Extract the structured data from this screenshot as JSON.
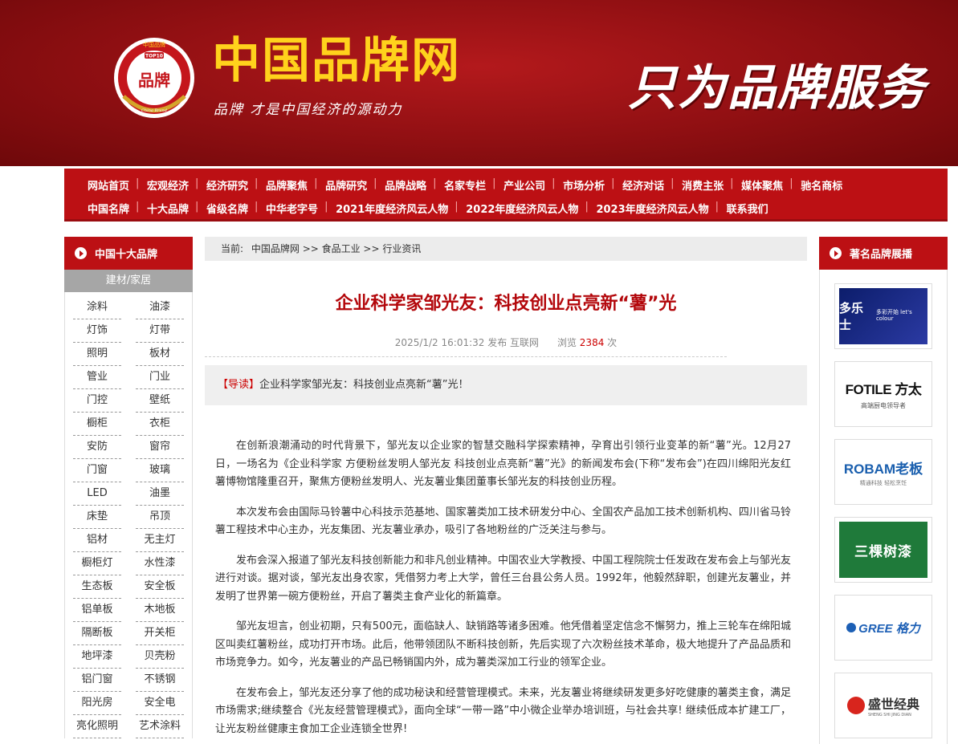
{
  "header": {
    "site_title": "中国品牌网",
    "slogan": "品牌  才是中国经济的源动力",
    "motto": "只为品牌服务",
    "seal_top": "中国品牌",
    "seal_badge": "TOP10",
    "seal_center": "品牌",
    "seal_bottom": "China Brand"
  },
  "nav": {
    "row1": [
      "网站首页",
      "宏观经济",
      "经济研究",
      "品牌聚焦",
      "品牌研究",
      "品牌战略",
      "名家专栏",
      "产业公司",
      "市场分析",
      "经济对话",
      "消费主张",
      "媒体聚焦",
      "驰名商标"
    ],
    "row2": [
      "中国名牌",
      "十大品牌",
      "省级名牌",
      "中华老字号",
      "2021年度经济风云人物",
      "2022年度经济风云人物",
      "2023年度经济风云人物",
      "联系我们"
    ]
  },
  "left_sidebar": {
    "title": "中国十大品牌",
    "category": "建材/家居",
    "items": [
      "涂料",
      "油漆",
      "灯饰",
      "灯带",
      "照明",
      "板材",
      "管业",
      "门业",
      "门控",
      "壁纸",
      "橱柜",
      "衣柜",
      "安防",
      "窗帘",
      "门窗",
      "玻璃",
      "LED",
      "油墨",
      "床垫",
      "吊顶",
      "铝材",
      "无主灯",
      "橱柜灯",
      "水性漆",
      "生态板",
      "安全板",
      "铝单板",
      "木地板",
      "隔断板",
      "开关柜",
      "地坪漆",
      "贝壳粉",
      "铝门窗",
      "不锈钢",
      "阳光房",
      "安全电",
      "亮化照明",
      "艺术涂料"
    ]
  },
  "breadcrumb": {
    "prefix": "当前:",
    "path": "中国品牌网 >> 食品工业 >> 行业资讯"
  },
  "article": {
    "title": "企业科学家邹光友：科技创业点亮新“薯”光",
    "date": "2025/1/2 16:01:32 发布",
    "source": "互联网",
    "views_label": "浏览",
    "views": "2384",
    "views_unit": "次",
    "lead_tag": "【导读】",
    "lead_text": "企业科学家邹光友：科技创业点亮新“薯”光！",
    "paragraphs": [
      "在创新浪潮涌动的时代背景下，邹光友以企业家的智慧交融科学探索精神，孕育出引领行业变革的新“薯”光。12月27日，一场名为《企业科学家 方便粉丝发明人邹光友 科技创业点亮新“薯”光》的新闻发布会(下称“发布会”)在四川绵阳光友红薯博物馆隆重召开，聚焦方便粉丝发明人、光友薯业集团董事长邹光友的科技创业历程。",
      "本次发布会由国际马铃薯中心科技示范基地、国家薯类加工技术研发分中心、全国农产品加工技术创新机构、四川省马铃薯工程技术中心主办，光友集团、光友薯业承办，吸引了各地粉丝的广泛关注与参与。",
      "发布会深入报道了邹光友科技创新能力和非凡创业精神。中国农业大学教授、中国工程院院士任发政在发布会上与邹光友进行对谈。据对谈，邹光友出身农家，凭借努力考上大学，曾任三台县公务人员。1992年，他毅然辞职，创建光友薯业，并发明了世界第一碗方便粉丝，开启了薯类主食产业化的新篇章。",
      "邹光友坦言，创业初期，只有500元，面临缺人、缺销路等诸多困难。他凭借着坚定信念不懈努力，推上三轮车在绵阳城区叫卖红薯粉丝，成功打开市场。此后，他带领团队不断科技创新，先后实现了六次粉丝技术革命，极大地提升了产品品质和市场竞争力。如今，光友薯业的产品已畅销国内外，成为薯类深加工行业的领军企业。",
      "在发布会上，邹光友还分享了他的成功秘诀和经营管理模式。未来，光友薯业将继续研发更多好吃健康的薯类主食，满足市场需求;继续整合《光友经营管理模式》，面向全球“一带一路”中小微企业举办培训班，与社会共享! 继续低成本扩建工厂，让光友粉丝健康主食加工企业连锁全世界!"
    ]
  },
  "right_sidebar": {
    "title": "著名品牌展播",
    "brands": [
      {
        "name": "多乐士",
        "sub": "多彩开始 let's colour"
      },
      {
        "name": "FOTILE 方太",
        "sub": "高端厨电领导者"
      },
      {
        "name": "ROBAM老板",
        "sub": "精通科技 轻松烹饪"
      },
      {
        "name": "三棵树漆",
        "sub": ""
      },
      {
        "name": "GREE 格力",
        "sub": ""
      },
      {
        "name": "盛世经典",
        "sub": "SHENG SHI JING DIAN"
      }
    ]
  },
  "colors": {
    "brand_red": "#bc1014",
    "title_red": "#b3070b",
    "header_gold": "#ffd21c"
  }
}
